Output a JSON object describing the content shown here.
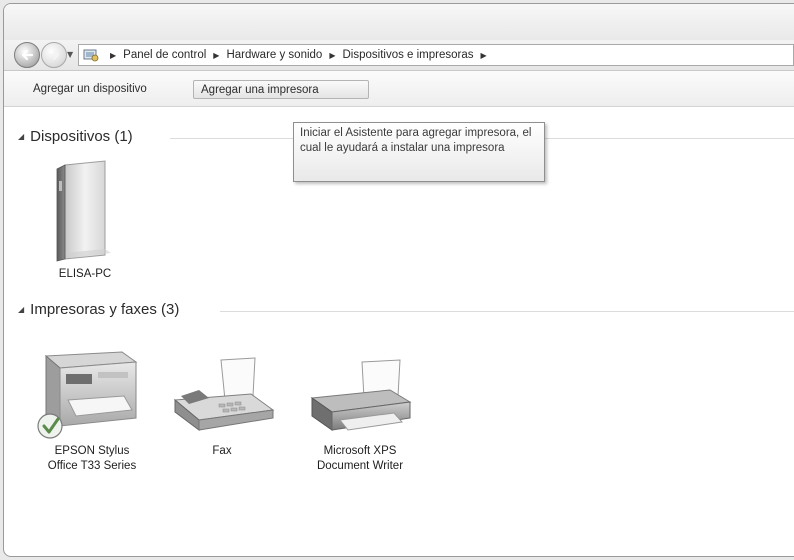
{
  "navigation": {
    "back_icon": "back-arrow-icon",
    "forward_icon": "forward-arrow-icon",
    "recent_icon": "chevron-down-icon"
  },
  "address_bar": {
    "icon": "control-panel-icon",
    "crumbs": [
      "Panel de control",
      "Hardware y sonido",
      "Dispositivos e impresoras"
    ]
  },
  "toolbar": {
    "add_device_label": "Agregar un dispositivo",
    "add_printer_label": "Agregar una impresora"
  },
  "tooltip": {
    "text": "Iniciar el Asistente para agregar impresora, el cual le ayudará a instalar una impresora"
  },
  "groups": [
    {
      "label": "Dispositivos (1)",
      "items": [
        {
          "line1": "ELISA-PC",
          "icon": "computer-tower-icon"
        }
      ]
    },
    {
      "label": "Impresoras y faxes (3)",
      "items": [
        {
          "line1": "EPSON Stylus",
          "line2": "Office T33 Series",
          "icon": "multifunction-printer-icon",
          "default": true
        },
        {
          "line1": "Fax",
          "icon": "fax-icon"
        },
        {
          "line1": "Microsoft XPS",
          "line2": "Document Writer",
          "icon": "printer-icon"
        }
      ]
    }
  ]
}
